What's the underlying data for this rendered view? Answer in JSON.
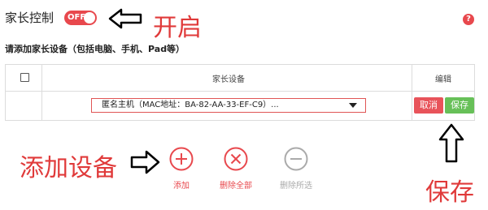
{
  "header": {
    "title": "家长控制",
    "toggle_state": "OFF",
    "help_glyph": "?"
  },
  "annotations": {
    "enable": "开启",
    "add_device": "添加设备",
    "save": "保存"
  },
  "instruction": "请添加家长设备（包括电脑、手机、Pad等）",
  "table": {
    "columns": [
      "家长设备",
      "编辑"
    ],
    "rows": [
      {
        "device": "匿名主机（MAC地址：BA-82-AA-33-EF-C9）...",
        "cancel_label": "取消",
        "save_label": "保存"
      }
    ]
  },
  "actions": {
    "add": "添加",
    "delete_all": "删除全部",
    "delete_selected": "删除所选"
  },
  "colors": {
    "accent_red": "#e8484d",
    "save_green": "#67c058",
    "disabled_gray": "#aaaaaa",
    "annotation_red": "#e03a3a"
  }
}
